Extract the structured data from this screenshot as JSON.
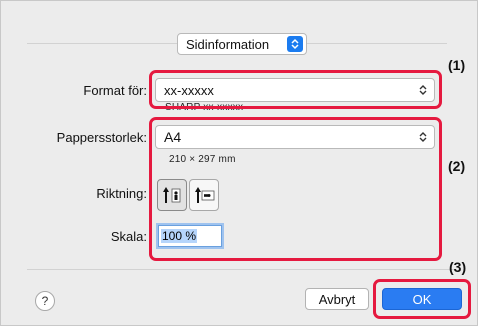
{
  "page_setup": {
    "section_popup": {
      "value": "Sidinformation",
      "icon": "stepper-icon"
    },
    "format_for": {
      "label": "Format för:",
      "value": "xx-xxxxx",
      "sub_label": "SHARP xx-xxxxx"
    },
    "paper_size": {
      "label": "Pappersstorlek:",
      "value": "A4",
      "dimensions": "210 × 297 mm"
    },
    "orientation": {
      "label": "Riktning:",
      "options": [
        {
          "name": "portrait",
          "icon": "portrait-orientation-icon",
          "selected": true
        },
        {
          "name": "landscape",
          "icon": "landscape-orientation-icon",
          "selected": false
        }
      ]
    },
    "scale": {
      "label": "Skala:",
      "value": "100 %"
    }
  },
  "buttons": {
    "help": "?",
    "cancel": "Avbryt",
    "ok": "OK"
  },
  "callouts": {
    "c1": "(1)",
    "c2": "(2)",
    "c3": "(3)"
  },
  "colors": {
    "highlight": "#e5193f",
    "accent": "#2a7cf2"
  }
}
